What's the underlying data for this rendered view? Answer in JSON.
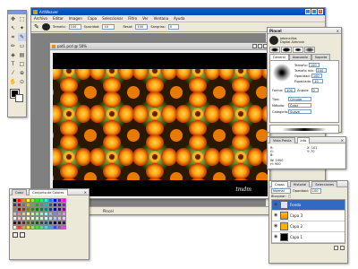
{
  "app": {
    "title": "ArtWeaver"
  },
  "menu": [
    "Archivo",
    "Editar",
    "Imagen",
    "Capa",
    "Seleccionar",
    "Filtro",
    "Ver",
    "Ventana",
    "Ayuda"
  ],
  "options": {
    "size_label": "Tamaño:",
    "size_value": "100",
    "opacity_label": "Opacidad:",
    "opacity_value": "10",
    "reset_label": "Resat:",
    "reset_value": "100",
    "indent_label": "Sangrías:",
    "indent_value": "0"
  },
  "document": {
    "title": "pat1.pcd @ 50%",
    "watermark": "tmdm"
  },
  "status": {
    "tool": "Pincel"
  },
  "brush_panel": {
    "title": "Pincel",
    "preset1": "Jaboncillos",
    "preset2": "Digital Airbrush",
    "tabs": [
      "General",
      "Avanzado",
      "Soporte"
    ],
    "size_label": "Tamaño:",
    "size_value": "100",
    "min_size_label": "Tamaño min:",
    "min_size_value": "100",
    "opacity_label": "Opacidad:",
    "opacity_value": "100",
    "spacing_label": "Espaciado:",
    "spacing_value": "10",
    "shape_label": "Forma:",
    "shape_value": "100",
    "angle_label": "Ángulo:",
    "angle_value": "0",
    "type_label": "Tipo:",
    "type_value": "Circular",
    "method_label": "Método:",
    "method_value": "Color",
    "category_label": "Categoría:",
    "category_value": "Suave"
  },
  "info_panel": {
    "tabs": [
      "Vista Previa",
      "Info"
    ],
    "r_label": "R:",
    "g_label": "G:",
    "b_label": "B:",
    "w_label": "W:",
    "w_value": "1900",
    "h_label": "H:",
    "h_value": "900",
    "x_label": "X:",
    "x_value": "101",
    "y_label": "Y:",
    "y_value": "70"
  },
  "color_panel": {
    "tabs": [
      "Color",
      "Conjunto de Colores"
    ]
  },
  "layers_panel": {
    "tabs": [
      "Capas",
      "Historial",
      "Selecciones"
    ],
    "mode": "Normal",
    "opacity_label": "Opacidad:",
    "opacity_value": "100",
    "lock_label": "Bloquear:",
    "layers": [
      {
        "name": "Fondo"
      },
      {
        "name": "Capa 3"
      },
      {
        "name": "Capa 2"
      },
      {
        "name": "Capa 1"
      }
    ]
  },
  "palette_colors": [
    "#000000",
    "#ff0000",
    "#ff7f00",
    "#ffff00",
    "#7fff00",
    "#00ff00",
    "#00ff7f",
    "#00ffff",
    "#007fff",
    "#0000ff",
    "#7f00ff",
    "#ff00ff",
    "#404040",
    "#c00000",
    "#c06000",
    "#c0c000",
    "#60c000",
    "#00c000",
    "#00c060",
    "#00c0c0",
    "#0060c0",
    "#0000c0",
    "#6000c0",
    "#c000c0",
    "#808080",
    "#800000",
    "#804000",
    "#808000",
    "#408000",
    "#008000",
    "#008040",
    "#008080",
    "#004080",
    "#000080",
    "#400080",
    "#800080",
    "#c0c0c0",
    "#ff8080",
    "#ffbf80",
    "#ffff80",
    "#bfff80",
    "#80ff80",
    "#80ffbf",
    "#80ffff",
    "#80bfff",
    "#8080ff",
    "#bf80ff",
    "#ff80ff",
    "#ffffff",
    "#ffc0c0",
    "#ffe0c0",
    "#ffffc0",
    "#e0ffc0",
    "#c0ffc0",
    "#c0ffe0",
    "#c0ffff",
    "#c0e0ff",
    "#c0c0ff",
    "#e0c0ff",
    "#ffc0ff",
    "#202020",
    "#600000",
    "#603000",
    "#606000",
    "#306000",
    "#006000",
    "#006030",
    "#006060",
    "#003060",
    "#000060",
    "#300060",
    "#600060",
    "#f0f0f0",
    "#e04040",
    "#e0a040",
    "#e0e040",
    "#a0e040",
    "#40e040",
    "#40e0a0",
    "#40e0e0",
    "#40a0e0",
    "#4040e0",
    "#a040e0",
    "#e040e0"
  ]
}
